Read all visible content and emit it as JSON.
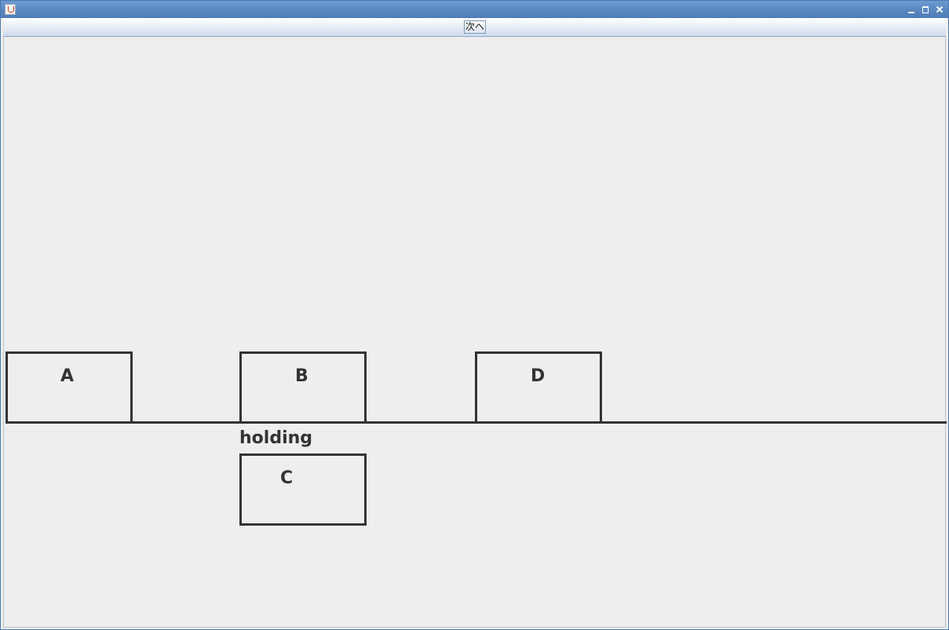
{
  "window": {
    "title": "",
    "controls": {
      "minimize_icon": "minimize-icon",
      "maximize_icon": "maximize-icon",
      "close_icon": "close-icon"
    }
  },
  "toolbar": {
    "next_label": "次へ"
  },
  "scene": {
    "blocks_on_table": [
      {
        "label": "A"
      },
      {
        "label": "B"
      },
      {
        "label": "D"
      }
    ],
    "holding_label": "holding",
    "held_block": {
      "label": "C"
    }
  },
  "colors": {
    "stroke": "#333333",
    "background": "#eeeeee",
    "titlebar": "#5b88c2"
  }
}
